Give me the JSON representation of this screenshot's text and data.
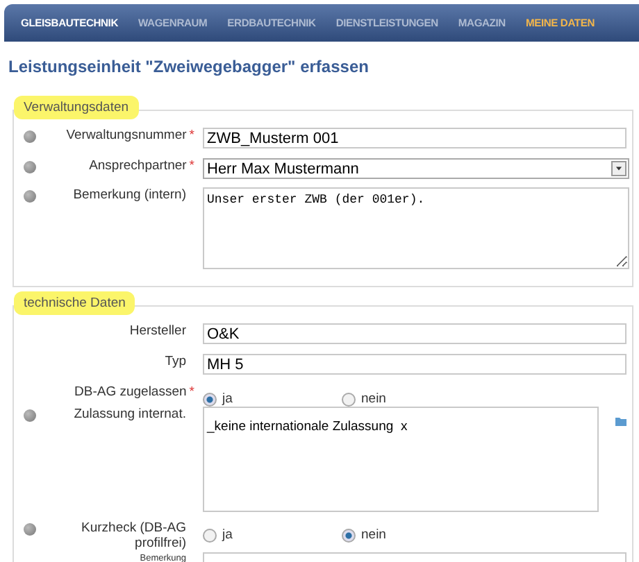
{
  "nav": [
    {
      "label": "GLEISBAUTECHNIK",
      "selected": true,
      "kind": "normal"
    },
    {
      "label": "WAGENRAUM",
      "selected": false,
      "kind": "normal"
    },
    {
      "label": "ERDBAUTECHNIK",
      "selected": false,
      "kind": "normal"
    },
    {
      "label": "DIENSTLEISTUNGEN",
      "selected": false,
      "kind": "normal"
    },
    {
      "label": "MAGAZIN",
      "selected": false,
      "kind": "normal"
    },
    {
      "label": "MEINE DATEN",
      "selected": false,
      "kind": "accent"
    }
  ],
  "title": "Leistungseinheit \"Zweiwegebagger\" erfassen",
  "sections": [
    {
      "legend": "Verwaltungsdaten",
      "rows": [
        {
          "kind": "text",
          "label": "Verwaltungsnummer",
          "required_mark": "*",
          "info": true,
          "value": "ZWB_Musterm 001"
        },
        {
          "kind": "select",
          "label": "Ansprechpartner",
          "required_mark": "*",
          "info": true,
          "value": "Herr Max Mustermann"
        },
        {
          "kind": "textarea",
          "label": "Bemerkung (intern)",
          "info": true,
          "value": "Unser erster ZWB (der 001er)."
        }
      ]
    },
    {
      "legend": "technische Daten",
      "rows": [
        {
          "kind": "text",
          "label": "Hersteller",
          "info": false,
          "value": "O&K"
        },
        {
          "kind": "text",
          "label": "Typ",
          "info": false,
          "value": "MH 5"
        },
        {
          "kind": "radio",
          "label": "DB-AG zugelassen",
          "required_mark": "*",
          "info": false,
          "options": [
            {
              "label": "ja",
              "selected": true
            },
            {
              "label": "nein",
              "selected": false
            }
          ]
        },
        {
          "kind": "tags",
          "label": "Zulassung internat.",
          "info": true,
          "tags": [
            {
              "label": "_keine internationale Zulassung",
              "remove": "x"
            }
          ]
        },
        {
          "kind": "radio",
          "label": "Kurzheck (DB-AG profilfrei)",
          "info": true,
          "options": [
            {
              "label": "ja",
              "selected": false
            },
            {
              "label": "nein",
              "selected": true
            }
          ]
        },
        {
          "kind": "small",
          "label": "Bemerkung",
          "info": false
        }
      ]
    }
  ]
}
